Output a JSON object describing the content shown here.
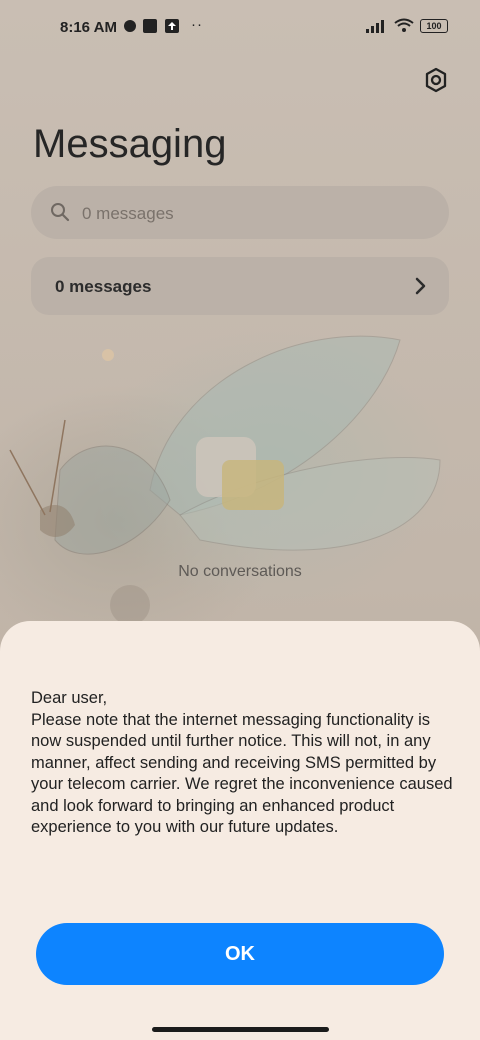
{
  "status_bar": {
    "time": "8:16 AM",
    "battery": "100"
  },
  "header": {
    "title": "Messaging"
  },
  "search": {
    "placeholder": "0 messages"
  },
  "summary": {
    "label": "0 messages"
  },
  "empty_state": {
    "text": "No conversations"
  },
  "dialog": {
    "message": "Dear user,\nPlease note that the internet messaging functionality is now suspended until further notice. This will not, in any manner, affect sending and receiving SMS permitted by your telecom carrier. We regret the inconvenience caused and look forward to bringing an enhanced product experience to you with our future updates.",
    "ok_label": "OK"
  },
  "colors": {
    "accent": "#0d84ff",
    "sheet": "#f6ebe2"
  }
}
